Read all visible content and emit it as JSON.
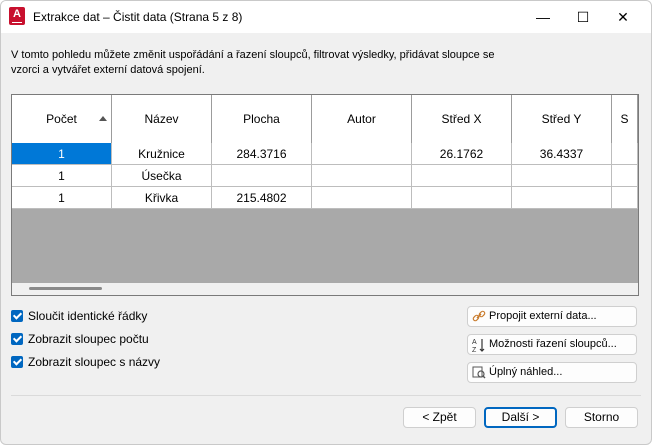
{
  "window": {
    "title": "Extrakce dat – Čistit data (Strana 5 z 8)",
    "app_icon_letter": "A",
    "minimize_glyph": "—",
    "maximize_glyph": "☐",
    "close_glyph": "✕"
  },
  "description": "V tomto pohledu můžete změnit uspořádání a řazení sloupců, filtrovat výsledky, přidávat sloupce se vzorci a vytvářet externí datová spojení.",
  "grid": {
    "columns": [
      "Počet",
      "Název",
      "Plocha",
      "Autor",
      "Střed X",
      "Střed Y",
      "S"
    ],
    "sorted_column": "Počet",
    "rows": [
      [
        "1",
        "Kružnice",
        "284.3716",
        "",
        "26.1762",
        "36.4337",
        ""
      ],
      [
        "1",
        "Úsečka",
        "",
        "",
        "",
        "",
        ""
      ],
      [
        "1",
        "Křivka",
        "215.4802",
        "",
        "",
        "",
        ""
      ]
    ],
    "selected_cell": "1"
  },
  "checkboxes": [
    {
      "label": "Sloučit identické řádky",
      "checked": true
    },
    {
      "label": "Zobrazit sloupec počtu",
      "checked": true
    },
    {
      "label": "Zobrazit sloupec s názvy",
      "checked": true
    }
  ],
  "side_buttons": [
    {
      "label": "Propojit externí data...",
      "icon": "link-icon"
    },
    {
      "label": "Možnosti řazení sloupců...",
      "icon": "sort-az-icon"
    },
    {
      "label": "Úplný náhled...",
      "icon": "preview-icon"
    }
  ],
  "footer": {
    "back_label": "< Zpět",
    "next_label": "Další >",
    "cancel_label": "Storno"
  },
  "colors": {
    "accent": "#0067c0",
    "selection": "#0078d7",
    "grid_empty_area": "#a9a9a9",
    "app_icon": "#c8102e"
  }
}
